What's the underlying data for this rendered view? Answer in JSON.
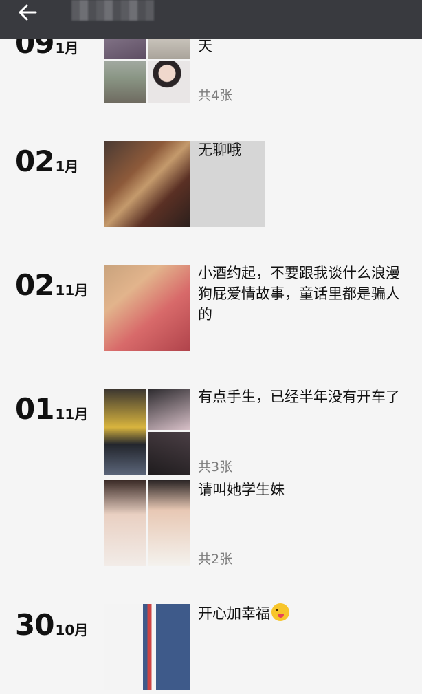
{
  "header": {
    "back_icon": "arrow-left-icon"
  },
  "posts": [
    {
      "day": "09",
      "month": "1月",
      "caption": "天",
      "count": "共4张"
    },
    {
      "day": "02",
      "month": "1月",
      "caption": "无聊哦"
    },
    {
      "day": "02",
      "month": "11月",
      "caption": "小酒约起，不要跟我谈什么浪漫狗屁爱情故事，童话里都是骗人的"
    },
    {
      "day": "01",
      "month": "11月",
      "caption": "有点手生，已经半年没有开车了",
      "count": "共3张"
    },
    {
      "caption": "请叫她学生妹",
      "count": "共2张"
    },
    {
      "day": "30",
      "month": "10月",
      "caption": "开心加幸福",
      "emoji": "winking-tongue-emoji"
    }
  ]
}
